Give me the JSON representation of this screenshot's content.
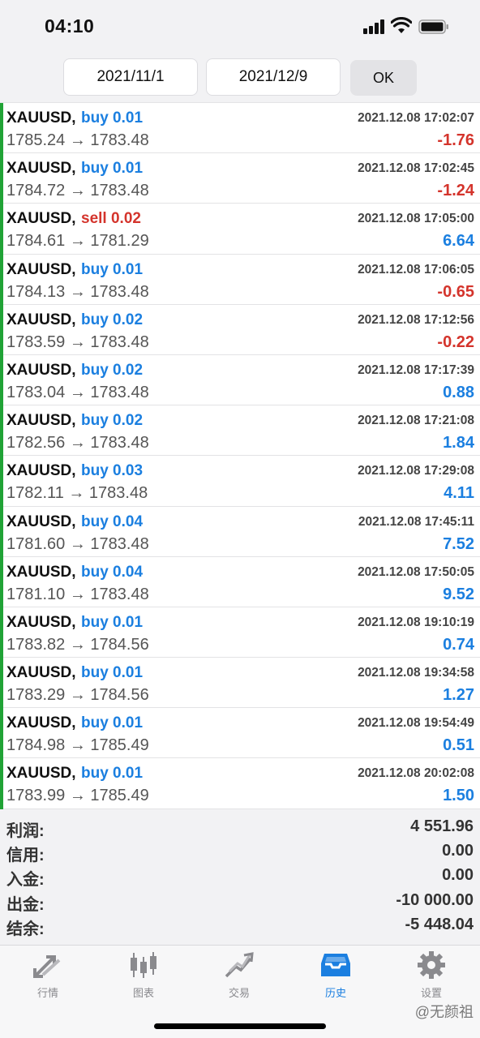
{
  "status_bar": {
    "time": "04:10"
  },
  "filter": {
    "from_date": "2021/11/1",
    "to_date": "2021/12/9",
    "ok_label": "OK"
  },
  "deals": [
    {
      "symbol": "XAUUSD,",
      "type": "buy 0.01",
      "side": "buy",
      "prices": "1785.24 → 1783.48",
      "time": "2021.12.08 17:02:07",
      "profit": "-1.76",
      "profit_sign": "neg"
    },
    {
      "symbol": "XAUUSD,",
      "type": "buy 0.01",
      "side": "buy",
      "prices": "1784.72 → 1783.48",
      "time": "2021.12.08 17:02:45",
      "profit": "-1.24",
      "profit_sign": "neg"
    },
    {
      "symbol": "XAUUSD,",
      "type": "sell 0.02",
      "side": "sell",
      "prices": "1784.61 → 1781.29",
      "time": "2021.12.08 17:05:00",
      "profit": "6.64",
      "profit_sign": "pos"
    },
    {
      "symbol": "XAUUSD,",
      "type": "buy 0.01",
      "side": "buy",
      "prices": "1784.13 → 1783.48",
      "time": "2021.12.08 17:06:05",
      "profit": "-0.65",
      "profit_sign": "neg"
    },
    {
      "symbol": "XAUUSD,",
      "type": "buy 0.02",
      "side": "buy",
      "prices": "1783.59 → 1783.48",
      "time": "2021.12.08 17:12:56",
      "profit": "-0.22",
      "profit_sign": "neg"
    },
    {
      "symbol": "XAUUSD,",
      "type": "buy 0.02",
      "side": "buy",
      "prices": "1783.04 → 1783.48",
      "time": "2021.12.08 17:17:39",
      "profit": "0.88",
      "profit_sign": "pos"
    },
    {
      "symbol": "XAUUSD,",
      "type": "buy 0.02",
      "side": "buy",
      "prices": "1782.56 → 1783.48",
      "time": "2021.12.08 17:21:08",
      "profit": "1.84",
      "profit_sign": "pos"
    },
    {
      "symbol": "XAUUSD,",
      "type": "buy 0.03",
      "side": "buy",
      "prices": "1782.11 → 1783.48",
      "time": "2021.12.08 17:29:08",
      "profit": "4.11",
      "profit_sign": "pos"
    },
    {
      "symbol": "XAUUSD,",
      "type": "buy 0.04",
      "side": "buy",
      "prices": "1781.60 → 1783.48",
      "time": "2021.12.08 17:45:11",
      "profit": "7.52",
      "profit_sign": "pos"
    },
    {
      "symbol": "XAUUSD,",
      "type": "buy 0.04",
      "side": "buy",
      "prices": "1781.10 → 1783.48",
      "time": "2021.12.08 17:50:05",
      "profit": "9.52",
      "profit_sign": "pos"
    },
    {
      "symbol": "XAUUSD,",
      "type": "buy 0.01",
      "side": "buy",
      "prices": "1783.82 → 1784.56",
      "time": "2021.12.08 19:10:19",
      "profit": "0.74",
      "profit_sign": "pos"
    },
    {
      "symbol": "XAUUSD,",
      "type": "buy 0.01",
      "side": "buy",
      "prices": "1783.29 → 1784.56",
      "time": "2021.12.08 19:34:58",
      "profit": "1.27",
      "profit_sign": "pos"
    },
    {
      "symbol": "XAUUSD,",
      "type": "buy 0.01",
      "side": "buy",
      "prices": "1784.98 → 1785.49",
      "time": "2021.12.08 19:54:49",
      "profit": "0.51",
      "profit_sign": "pos"
    },
    {
      "symbol": "XAUUSD,",
      "type": "buy 0.01",
      "side": "buy",
      "prices": "1783.99 → 1785.49",
      "time": "2021.12.08 20:02:08",
      "profit": "1.50",
      "profit_sign": "pos"
    }
  ],
  "summary": [
    {
      "label": "利润:",
      "value": "4 551.96"
    },
    {
      "label": "信用:",
      "value": "0.00"
    },
    {
      "label": "入金:",
      "value": "0.00"
    },
    {
      "label": "出金:",
      "value": "-10 000.00"
    },
    {
      "label": "结余:",
      "value": "-5 448.04"
    }
  ],
  "tabs": [
    {
      "label": "行情",
      "icon": "quotes-arrows-icon",
      "active": false
    },
    {
      "label": "图表",
      "icon": "candlestick-chart-icon",
      "active": false
    },
    {
      "label": "交易",
      "icon": "trade-trend-icon",
      "active": false
    },
    {
      "label": "历史",
      "icon": "history-inbox-icon",
      "active": true
    },
    {
      "label": "设置",
      "icon": "settings-gear-icon",
      "active": false
    }
  ],
  "watermark": "@无颜祖",
  "colors": {
    "buy": "#1b7fe0",
    "sell": "#d4342c",
    "positive": "#1b7fe0",
    "negative": "#d4342c",
    "row_marker": "#21a336",
    "active_tab": "#1b7fe0",
    "inactive_tab": "#8a8a8e"
  }
}
